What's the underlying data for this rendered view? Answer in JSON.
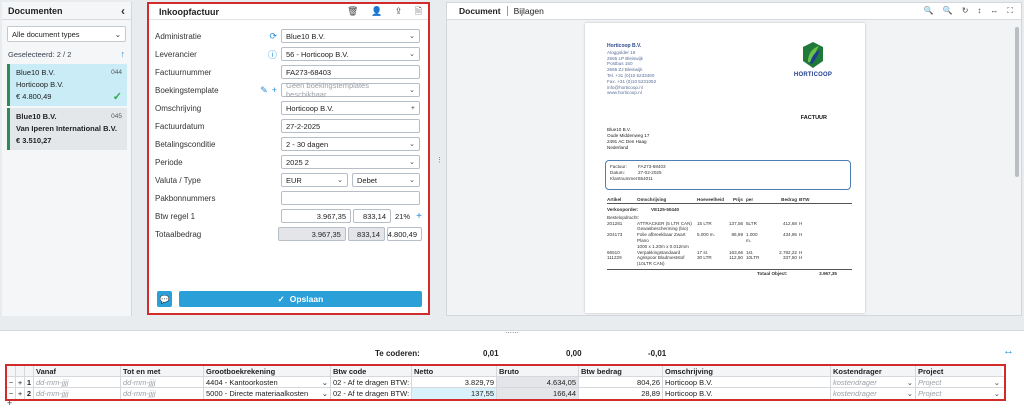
{
  "left": {
    "title": "Documenten",
    "filter": "Alle document types",
    "selected_text": "Geselecteerd: 2 / 2",
    "cards": [
      {
        "line1": "Blue10 B.V.",
        "num": "044",
        "line2": "Horticoop B.V.",
        "amount": "€ 4.800,49"
      },
      {
        "line1": "Blue10 B.V.",
        "num": "045",
        "line2": "Van Iperen International B.V.",
        "amount": "€ 3.510,27"
      }
    ]
  },
  "form": {
    "title": "Inkoopfactuur",
    "fields": {
      "administratie": {
        "label": "Administratie",
        "value": "Blue10 B.V."
      },
      "leverancier": {
        "label": "Leverancier",
        "value": "56 - Horticoop B.V."
      },
      "factuurnummer": {
        "label": "Factuurnummer",
        "value": "FA273-68403"
      },
      "boekingstemplate": {
        "label": "Boekingstemplate",
        "value": "Geen boekingstemplates beschikbaar"
      },
      "omschrijving": {
        "label": "Omschrijving",
        "value": "Horticoop B.V."
      },
      "factuurdatum": {
        "label": "Factuurdatum",
        "value": "27-2-2025"
      },
      "betalingsconditie": {
        "label": "Betalingsconditie",
        "value": "2 - 30 dagen"
      },
      "periode": {
        "label": "Periode",
        "value": "2025 2"
      },
      "valuta": {
        "label": "Valuta / Type",
        "value": "EUR",
        "type": "Debet"
      },
      "pakbon": {
        "label": "Pakbonnummers",
        "value": ""
      },
      "btw": {
        "label": "Btw regel 1",
        "amount": "3.967,35",
        "vat": "833,14",
        "pct": "21%"
      },
      "totaal": {
        "label": "Totaalbedrag",
        "amount": "3.967,35",
        "vat": "833,14",
        "total": "4.800,49"
      }
    },
    "save_label": "Opslaan"
  },
  "viewer": {
    "tabs": [
      "Document",
      "Bijlagen"
    ],
    "doc": {
      "sender_name": "Horticoop B.V.",
      "sender_lines": [
        "Aloggolder 16",
        "2665 LP Bleiswijk",
        "Postbus 150",
        "2665 ZJ Bleiswijk",
        "Tel. +31 (0)10 5233460",
        "Fax. +31 (0)10 5231052",
        "info@horticoop.nl",
        "www.horticoop.nl"
      ],
      "logo_text": "HORTICOOP",
      "doc_title": "FACTUUR",
      "addr_lines": [
        "Blue10 B.V.",
        "Oude Middenweg 17",
        "2491 AC Den Haag",
        "Nederland"
      ],
      "inv": [
        {
          "k": "Factuur:",
          "v": "FA273-68403"
        },
        {
          "k": "Datum:",
          "v": "27-02-2025"
        },
        {
          "k": "Klantnummer:",
          "v": "654011"
        }
      ],
      "table_head": [
        "Artikel",
        "Omschrijving",
        "Hoeveelheid",
        "Prijs",
        "per",
        "Bedrag",
        "BTW"
      ],
      "verkooporder_label": "Verkooporder:",
      "verkooporder": "VE125-50440",
      "bestel_label": "Bestelopdracht:",
      "rows": [
        [
          "201281",
          "ATTRACKER (5 LTR CAN)",
          "15 LTR",
          "137,56",
          "5LTR",
          "412,68",
          "H"
        ],
        [
          "",
          "Gewasbescherming (bio)",
          "",
          "",
          "",
          "",
          ""
        ],
        [
          "204173",
          "Folie afbreekbaar Zwart Plano",
          "5.000 m.",
          "86,99",
          "1.000 m.",
          "434,95",
          "H"
        ],
        [
          "",
          "1000 x 1.20m x 0.012mm",
          "",
          "",
          "",
          "",
          ""
        ],
        [
          "66510",
          "Verpakkingstandaard",
          "17 st.",
          "163,66",
          "1st.",
          "2.782,22",
          "H"
        ],
        [
          "111229",
          "Agrispoor Bladmeststof",
          "30 LTR",
          "112,50",
          "10LTR",
          "337,50",
          "H"
        ],
        [
          "",
          "(10LTR CAN)",
          "",
          "",
          "",
          "",
          ""
        ]
      ],
      "total_label": "Totaal Object:",
      "total": "3.967,35"
    }
  },
  "bottom": {
    "te_coderen": "Te coderen:",
    "vals": [
      "0,01",
      "0,00",
      "-0,01"
    ],
    "headers": [
      "Vanaf",
      "Tot en met",
      "Grootboekrekening",
      "Btw code",
      "Netto",
      "Bruto",
      "Btw bedrag",
      "Omschrijving",
      "Kostendrager",
      "Project"
    ],
    "rows": [
      {
        "n": "1",
        "vanaf": "dd-mm-jjjj",
        "tot": "dd-mm-jjjj",
        "grb": "4404 - Kantoorkosten",
        "btw": "02 - Af te dragen BTW:",
        "netto": "3.829,79",
        "bruto": "4.634,05",
        "btwb": "804,26",
        "oms": "Horticoop B.V.",
        "kost": "kostendrager",
        "proj": "Project"
      },
      {
        "n": "2",
        "vanaf": "dd-mm-jjjj",
        "tot": "dd-mm-jjjj",
        "grb": "5000 - Directe materiaalkosten",
        "btw": "02 - Af te dragen BTW:",
        "netto": "137,55",
        "bruto": "166,44",
        "btwb": "28,89",
        "oms": "Horticoop B.V.",
        "kost": "kostendrager",
        "proj": "Project"
      }
    ]
  }
}
